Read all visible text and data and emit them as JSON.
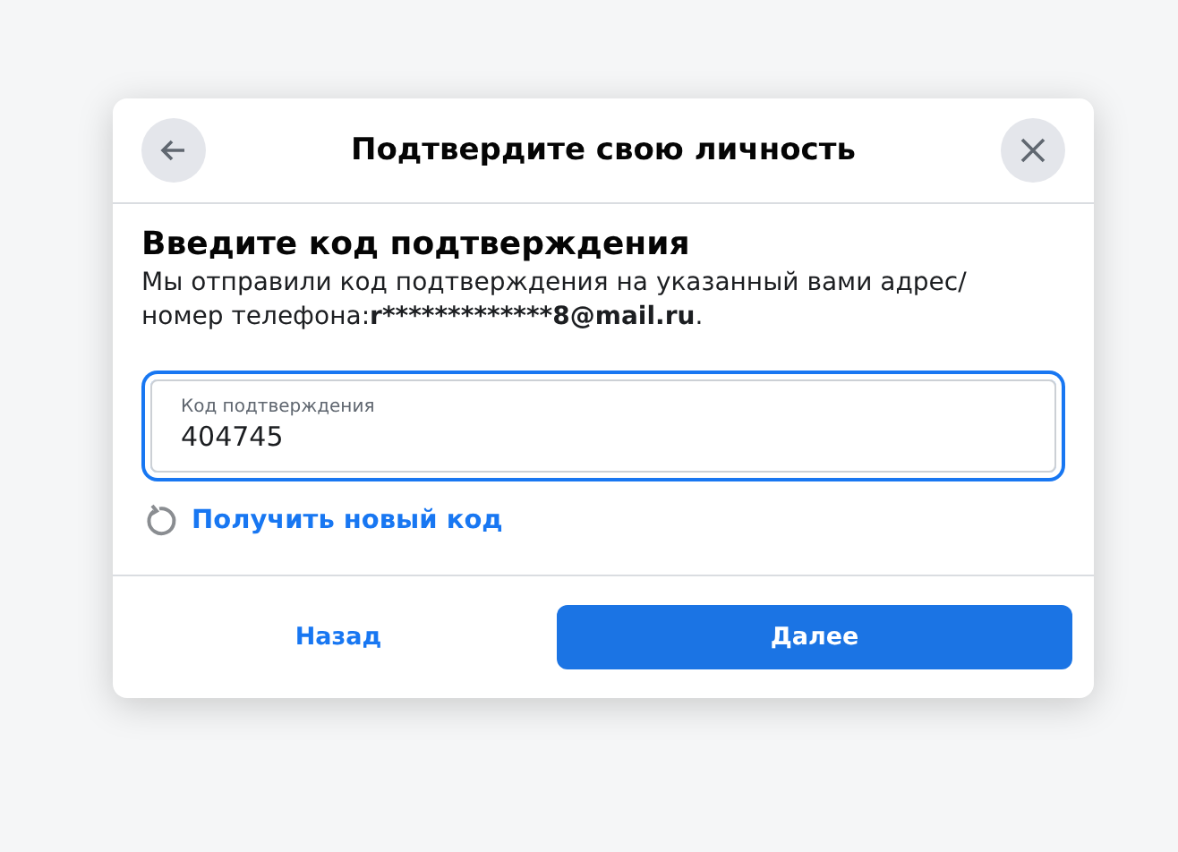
{
  "dialog": {
    "title": "Подтвердите свою личность",
    "heading": "Введите код подтверждения",
    "message": {
      "text": "Мы отправили код подтверждения на указанный вами адрес/ номер телефона:",
      "contact": "r*************8@mail.ru",
      "end": "."
    },
    "code_field": {
      "label": "Код подтверждения",
      "value": "404745"
    },
    "resend_link": "Получить новый код",
    "buttons": [
      {
        "label": "Назад",
        "kind": "secondary"
      },
      {
        "label": "Далее",
        "kind": "primary"
      }
    ]
  }
}
